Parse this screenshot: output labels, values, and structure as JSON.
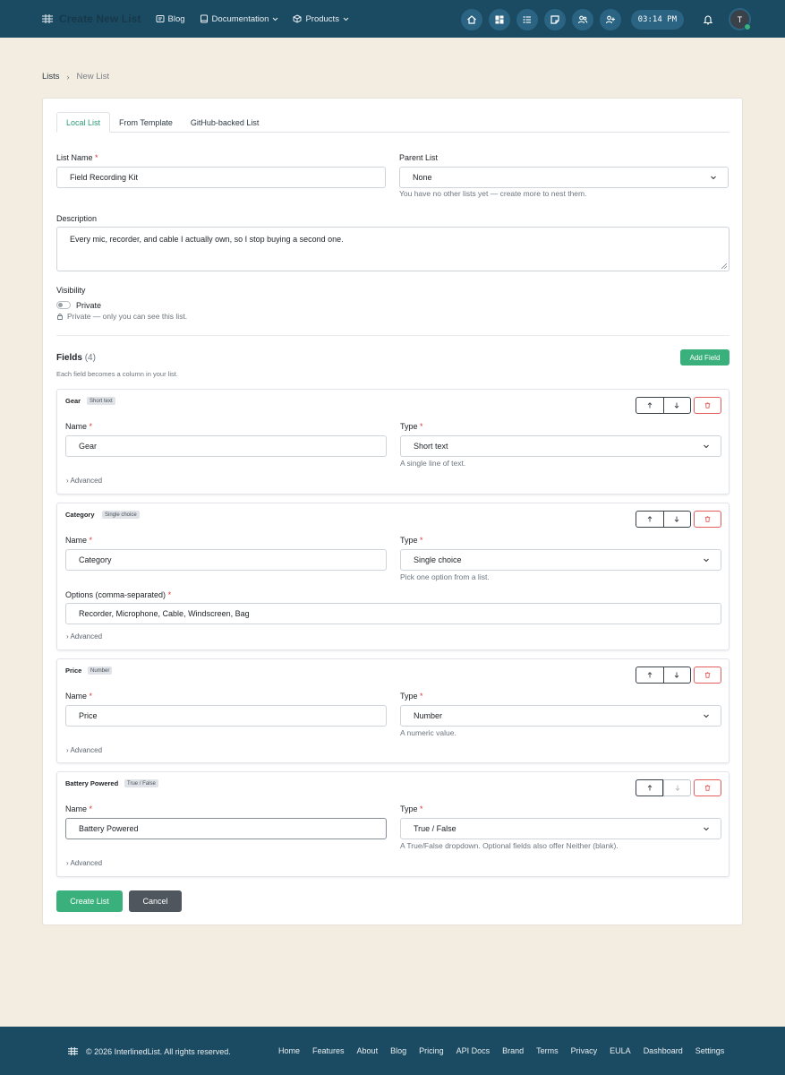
{
  "nav": {
    "title": "Create New List",
    "links": [
      {
        "label": "Blog"
      },
      {
        "label": "Documentation"
      },
      {
        "label": "Products"
      }
    ],
    "clock": "03:14 PM",
    "avatar_initial": "T"
  },
  "breadcrumb": {
    "root": "Lists",
    "current": "New List"
  },
  "tabs": [
    "Local List",
    "From Template",
    "GitHub-backed List"
  ],
  "form": {
    "list_name_label": "List Name",
    "list_name_value": "Field Recording Kit",
    "parent_label": "Parent List",
    "parent_value": "None",
    "parent_help": "You have no other lists yet — create more to nest them.",
    "description_label": "Description",
    "description_value": "Every mic, recorder, and cable I actually own, so I stop buying a second one.",
    "visibility_label": "Visibility",
    "visibility_toggle": "Private",
    "visibility_help": "Private — only you can see this list."
  },
  "fields_section": {
    "title": "Fields",
    "count": "(4)",
    "help": "Each field becomes a column in your list.",
    "add_label": "Add Field",
    "name_label": "Name",
    "type_label": "Type",
    "advanced_label": "› Advanced",
    "fields": [
      {
        "title": "Gear",
        "badge": "Short text",
        "name": "Gear",
        "type": "Short text",
        "type_help": "A single line of text."
      },
      {
        "title": "Category",
        "badge": "Single choice",
        "name": "Category",
        "type": "Single choice",
        "type_help": "Pick one option from a list.",
        "options_label": "Options (comma-separated)",
        "options_value": "Recorder, Microphone, Cable, Windscreen, Bag"
      },
      {
        "title": "Price",
        "badge": "Number",
        "name": "Price",
        "type": "Number",
        "type_help": "A numeric value."
      },
      {
        "title": "Battery Powered",
        "badge": "True / False",
        "name": "Battery Powered",
        "type": "True / False",
        "type_help": "A True/False dropdown. Optional fields also offer Neither (blank)."
      }
    ]
  },
  "actions": {
    "create": "Create List",
    "cancel": "Cancel"
  },
  "footer": {
    "copyright": "© 2026 InterlinedList. All rights reserved.",
    "links": [
      "Home",
      "Features",
      "About",
      "Blog",
      "Pricing",
      "API Docs",
      "Brand",
      "Terms",
      "Privacy",
      "EULA",
      "Dashboard",
      "Settings"
    ]
  },
  "colors": {
    "nav_bg": "#1b4b62",
    "accent": "#3ab07c",
    "page_bg": "#f3ece1",
    "danger": "#e35d5d"
  },
  "icons": [
    "logo-icon",
    "blog-icon",
    "documentation-icon",
    "products-icon",
    "home-icon",
    "dashboard-icon",
    "list-icon",
    "note-icon",
    "users-icon",
    "add-user-icon",
    "bell-icon",
    "lock-icon",
    "arrow-up-icon",
    "arrow-down-icon",
    "trash-icon",
    "chevron-down-icon"
  ]
}
